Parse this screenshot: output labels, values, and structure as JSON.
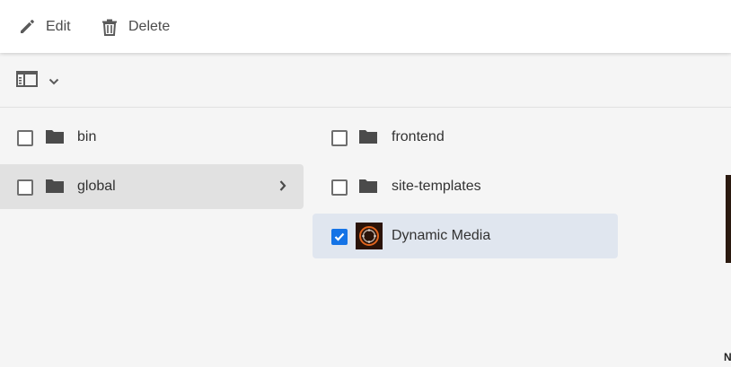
{
  "toolbar": {
    "edit_label": "Edit",
    "delete_label": "Delete"
  },
  "viewbar": {
    "icons": [
      "column-view-icon",
      "chevron-down-icon"
    ]
  },
  "columns": [
    {
      "items": [
        {
          "label": "bin",
          "type": "folder",
          "checked": false,
          "active": false
        },
        {
          "label": "global",
          "type": "folder",
          "checked": false,
          "active": true
        }
      ]
    },
    {
      "items": [
        {
          "label": "frontend",
          "type": "folder",
          "checked": false
        },
        {
          "label": "site-templates",
          "type": "folder",
          "checked": false
        },
        {
          "label": "Dynamic Media",
          "type": "configuration",
          "checked": true
        }
      ]
    }
  ],
  "preview": {
    "corner_text": "N"
  },
  "colors": {
    "accent": "#1473e6",
    "selected_row": "#e0e6ef",
    "active_row": "#e1e1e1",
    "background": "#f5f5f5"
  }
}
